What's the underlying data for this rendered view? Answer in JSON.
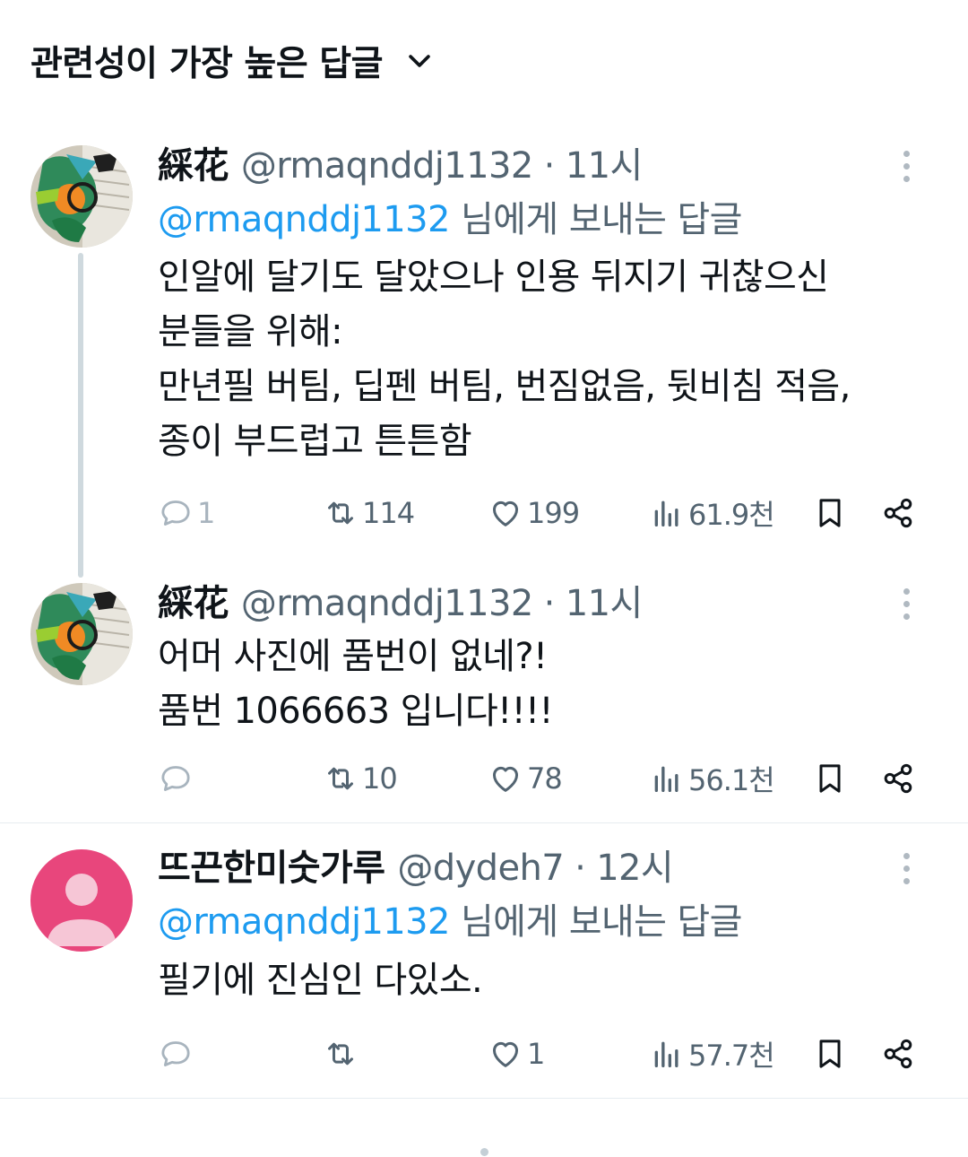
{
  "header": {
    "sort_label": "관련성이 가장 높은 답글"
  },
  "replies": [
    {
      "name": "綵花",
      "handle": "@rmaqnddj1132",
      "time": "11시",
      "reply_prefix": "@rmaqnddj1132",
      "reply_suffix": " 님에게 보내는 답글",
      "body": [
        "인알에 달기도 달았으나 인용 뒤지기 귀찮으신",
        "분들을 위해:",
        "만년필 버팀, 딥펜 버팀, 번짐없음, 뒷비침 적음,",
        "종이 부드럽고 튼튼함"
      ],
      "stats": {
        "replies": "1",
        "reposts": "114",
        "likes": "199",
        "views": "61.9천"
      }
    },
    {
      "name": "綵花",
      "handle": "@rmaqnddj1132",
      "time": "11시",
      "body": [
        "어머 사진에 품번이 없네?!",
        "품번 1066663 입니다!!!!"
      ],
      "stats": {
        "replies": "",
        "reposts": "10",
        "likes": "78",
        "views": "56.1천"
      }
    },
    {
      "name": "뜨끈한미숫가루",
      "handle": "@dydeh7",
      "time": "12시",
      "reply_prefix": "@rmaqnddj1132",
      "reply_suffix": " 님에게 보내는 답글",
      "body": [
        "필기에 진심인 다있소."
      ],
      "stats": {
        "replies": "",
        "reposts": "",
        "likes": "1",
        "views": "57.7천"
      }
    }
  ],
  "colors": {
    "link": "#1d9bf0",
    "muted": "#536471",
    "text": "#0f1419",
    "divider": "#e6ecf0",
    "thread_line": "#cfd9de",
    "default_avatar_bg": "#e8467c"
  },
  "icons": [
    "chevron-down-icon",
    "more-icon",
    "reply-icon",
    "repost-icon",
    "like-icon",
    "views-icon",
    "bookmark-icon",
    "share-icon"
  ]
}
